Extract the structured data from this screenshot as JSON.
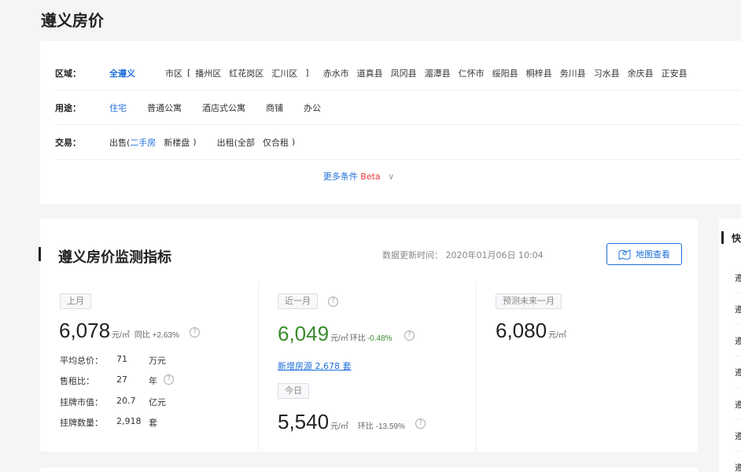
{
  "page": {
    "title": "遵义房价"
  },
  "filters": {
    "region": {
      "label": "区域：",
      "all": "全遵义",
      "city_label": "市区",
      "bracket_open": "[",
      "districts": [
        "播州区",
        "红花岗区",
        "汇川区"
      ],
      "bracket_close": "]",
      "counties": [
        "赤水市",
        "道真县",
        "凤冈县",
        "湄潭县",
        "仁怀市",
        "绥阳县",
        "桐梓县",
        "务川县",
        "习水县",
        "余庆县",
        "正安县"
      ]
    },
    "usage": {
      "label": "用途：",
      "options": [
        "住宅",
        "普通公寓",
        "酒店式公寓",
        "商铺",
        "办公"
      ]
    },
    "trade": {
      "label": "交易：",
      "sale_label": "出售(",
      "sale_opts": [
        "二手房",
        "新楼盘"
      ],
      "sale_close": ")",
      "rent_label": "出租(",
      "rent_opts": [
        "全部",
        "仅合租"
      ],
      "rent_close": ")"
    },
    "more": {
      "text": "更多条件",
      "beta": "Beta",
      "chev": "∨"
    }
  },
  "monitor": {
    "title": "遵义房价监测指标",
    "update_time": "数据更新时间： 2020年01月06日 10:04",
    "map_button": "地图查看",
    "last_month": {
      "tag": "上月",
      "price": "6,078",
      "unit": "元/㎡",
      "change": "同比 +2.63%",
      "stats": [
        {
          "k": "平均总价：",
          "v": "71",
          "u": "万元"
        },
        {
          "k": "售租比：",
          "v": "27",
          "u": "年"
        },
        {
          "k": "挂牌市值：",
          "v": "20.7",
          "u": "亿元"
        },
        {
          "k": "挂牌数量：",
          "v": "2,918",
          "u": "套"
        }
      ]
    },
    "recent_month": {
      "tag": "近一月",
      "price": "6,049",
      "unit": "元/㎡",
      "change_label": "环比",
      "change_value": "-0.48%",
      "new_listings": "新增房源 2,678 套"
    },
    "today": {
      "tag": "今日",
      "price": "5,540",
      "unit": "元/㎡",
      "change": "环比 -13.59%"
    },
    "forecast": {
      "tag": "预测未来一月",
      "price": "6,080",
      "unit": "元/㎡"
    }
  },
  "sidebar": {
    "head": "快",
    "items": [
      "遵",
      "遵",
      "遵",
      "遵",
      "遵",
      "遵",
      "遵"
    ]
  },
  "colors": {
    "accent": "#1e6fd9",
    "green": "#3b8a2e",
    "red": "#e5383b"
  },
  "icons": {
    "help": "question-circle-icon",
    "map": "map-pin-icon"
  }
}
